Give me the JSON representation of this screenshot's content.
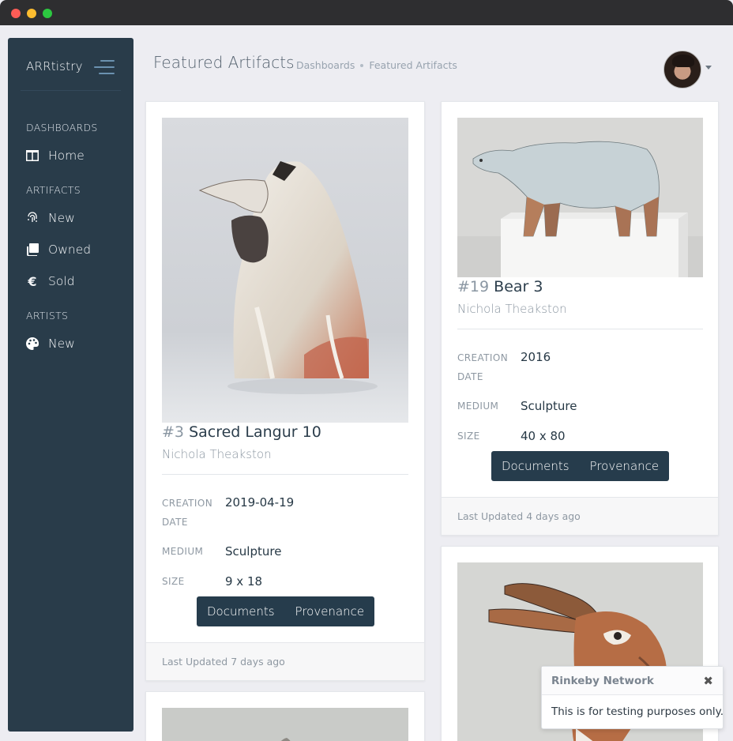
{
  "sidebar": {
    "brand": "ARRtistry",
    "sections": [
      {
        "label": "DASHBOARDS",
        "items": [
          {
            "label": "Home",
            "icon": "columns-icon"
          }
        ]
      },
      {
        "label": "ARTIFACTS",
        "items": [
          {
            "label": "New",
            "icon": "fingerprint-icon"
          },
          {
            "label": "Owned",
            "icon": "copy-icon"
          },
          {
            "label": "Sold",
            "icon": "euro-icon"
          }
        ]
      },
      {
        "label": "ARTISTS",
        "items": [
          {
            "label": "New",
            "icon": "palette-icon"
          }
        ]
      }
    ]
  },
  "header": {
    "title": "Featured Artifacts",
    "breadcrumbs": [
      "Dashboards",
      "Featured Artifacts"
    ]
  },
  "cards": [
    {
      "number": "#3",
      "title": "Sacred Langur 10",
      "artist": "Nichola Theakston",
      "creation_label": "CREATION DATE",
      "creation_value": "2019-04-19",
      "medium_label": "MEDIUM",
      "medium_value": "Sculpture",
      "size_label": "SIZE",
      "size_value": "9 x 18",
      "documents_label": "Documents",
      "provenance_label": "Provenance",
      "footer": "Last Updated 7 days ago"
    },
    {
      "number": "#19",
      "title": "Bear 3",
      "artist": "Nichola Theakston",
      "creation_label": "CREATION DATE",
      "creation_value": "2016",
      "medium_label": "MEDIUM",
      "medium_value": "Sculpture",
      "size_label": "SIZE",
      "size_value": "40 x 80",
      "documents_label": "Documents",
      "provenance_label": "Provenance",
      "footer": "Last Updated 4 days ago"
    }
  ],
  "toast": {
    "title": "Rinkeby Network",
    "close": "✖",
    "message": "This is for testing purposes only."
  },
  "colors": {
    "sidebar_bg": "#293c4a",
    "button_bg": "#263c4c",
    "page_bg": "#ededf2"
  }
}
